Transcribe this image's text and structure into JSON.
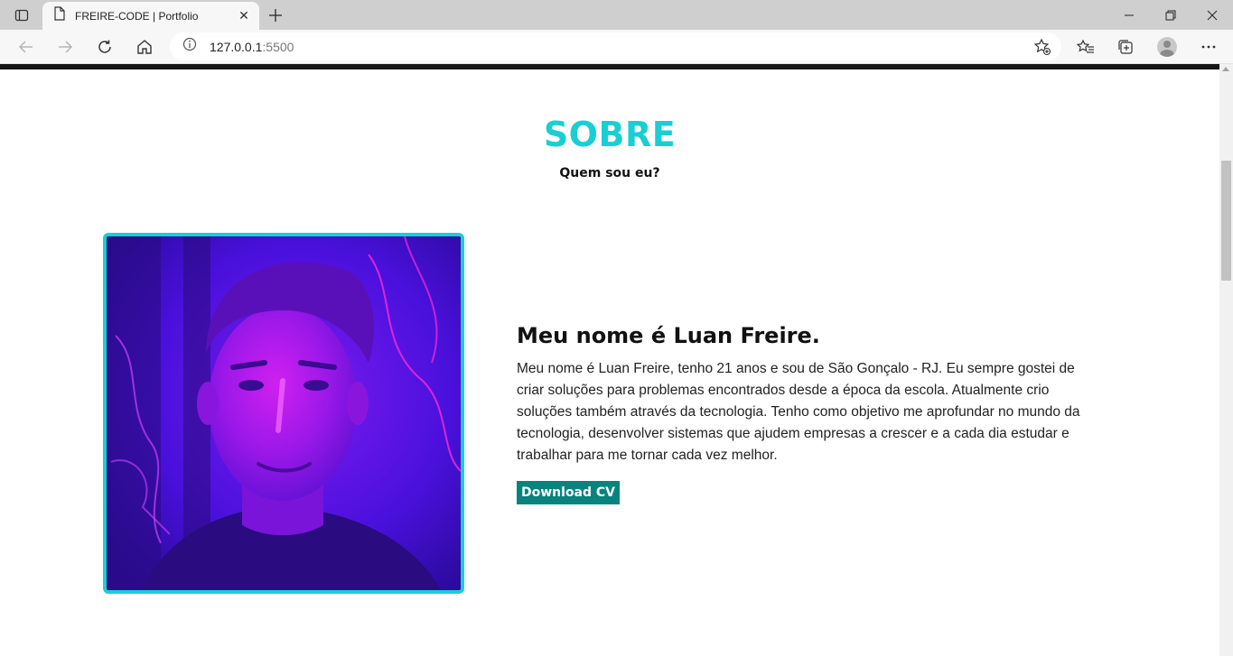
{
  "browser": {
    "tab_title": "FREIRE-CODE | Portfolio",
    "url_host": "127.0.0.1",
    "url_port": ":5500"
  },
  "about": {
    "title": "SOBRE",
    "subtitle": "Quem sou eu?",
    "heading": "Meu nome é Luan Freire.",
    "description": "Meu nome é Luan Freire, tenho 21 anos e sou de São Gonçalo - RJ. Eu sempre gostei de criar soluções para problemas encontrados desde a época da escola. Atualmente crio soluções também através da tecnologia. Tenho como objetivo me aprofundar no mundo da tecnologia, desenvolver sistemas que ajudem empresas a crescer e a cada dia estudar e trabalhar para me tornar cada vez melhor.",
    "cv_button": "Download CV"
  },
  "colors": {
    "accent": "#19cfd3",
    "button": "#08837e",
    "photo_tint": "#5a12e0"
  }
}
